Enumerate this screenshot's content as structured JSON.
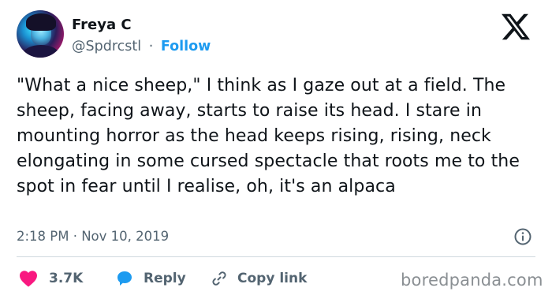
{
  "author": {
    "name": "Freya C",
    "handle": "@Spdrcstl",
    "separator": "·",
    "follow_label": "Follow"
  },
  "tweet": {
    "text": "\"What a nice sheep,\" I think as I gaze out at a field. The sheep, facing away, starts to raise its head. I stare in mounting horror as the head keeps rising, rising, neck elongating in some cursed spectacle that roots me to the spot in fear until I realise, oh, it's an alpaca",
    "timestamp": "2:18 PM · Nov 10, 2019"
  },
  "actions": {
    "like_count": "3.7K",
    "reply_label": "Reply",
    "copy_link_label": "Copy link"
  },
  "watermark": "boredpanda.com",
  "icons": {
    "brand": "x-logo-icon",
    "like": "heart-icon",
    "reply": "speech-bubble-icon",
    "copy": "link-icon",
    "info": "info-icon"
  },
  "colors": {
    "accent": "#1d9bf0",
    "like": "#f91880",
    "text": "#0f1419",
    "muted": "#536471",
    "watermark": "#8a8f93"
  }
}
